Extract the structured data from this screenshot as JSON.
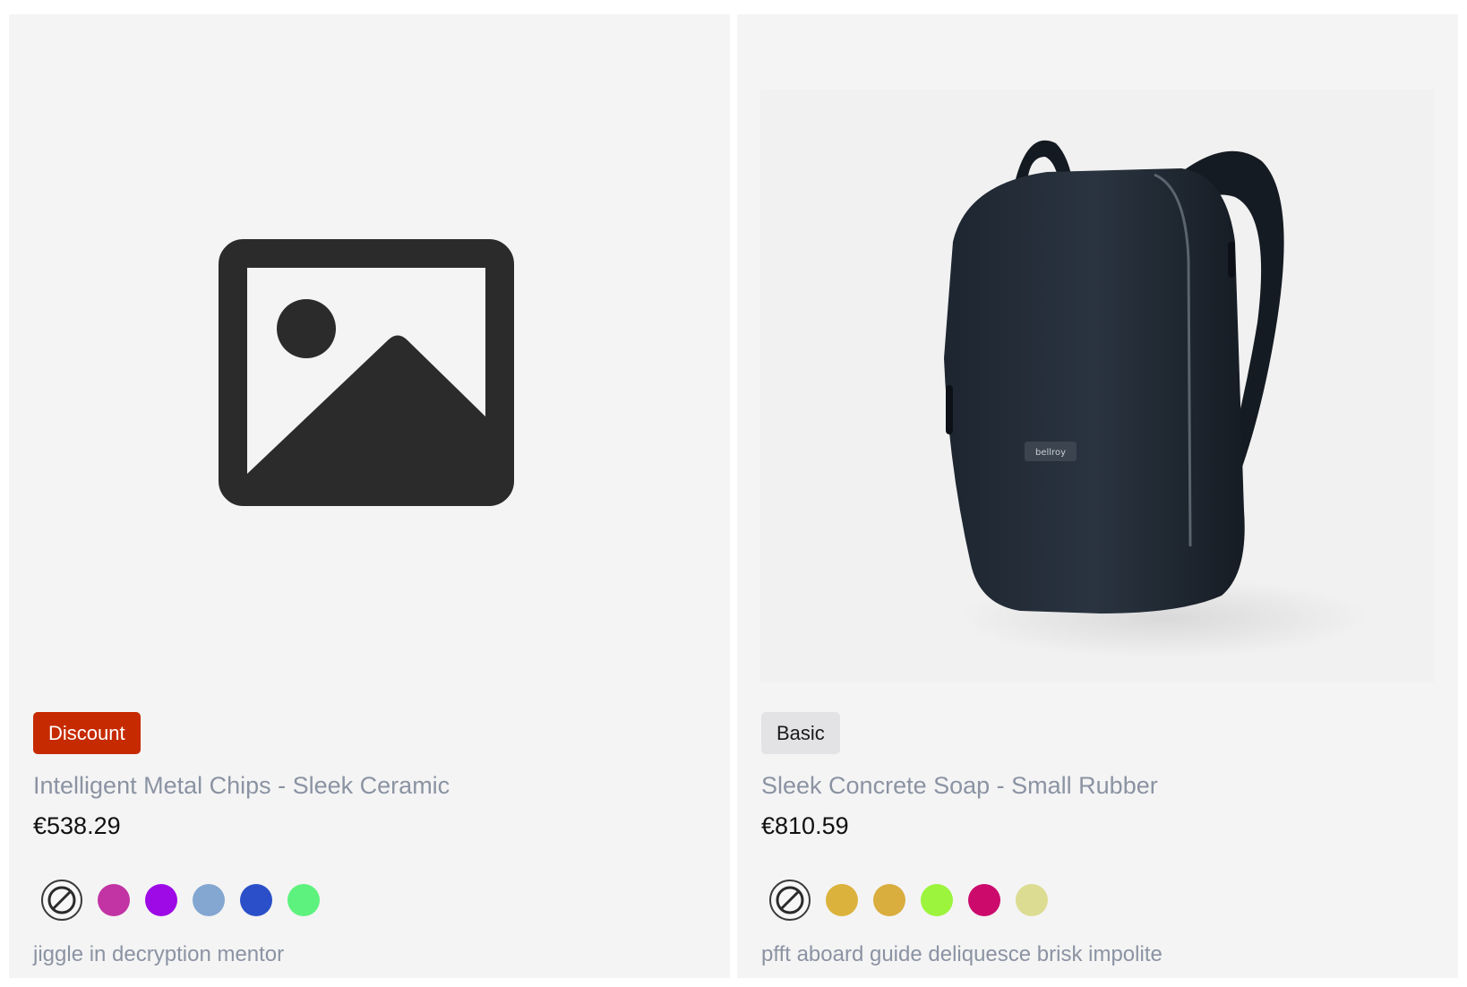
{
  "products": [
    {
      "badge": "Discount",
      "badge_color": "#c62a00",
      "image": "placeholder-image-icon",
      "name": "Intelligent Metal Chips - Sleek Ceramic",
      "price": "€538.29",
      "swatches": [
        "#c233a4",
        "#9d0ae6",
        "#84a7d2",
        "#2b4fc8",
        "#5df27e"
      ],
      "description": "jiggle in decryption mentor"
    },
    {
      "badge": "Basic",
      "badge_color": "#e3e3e6",
      "image": "backpack-photo",
      "image_brand_label": "bellroy",
      "name": "Sleek Concrete Soap - Small Rubber",
      "price": "€810.59",
      "swatches": [
        "#dbb23b",
        "#d9ad3e",
        "#9cf43d",
        "#cb0a6c",
        "#dcdc93"
      ],
      "description": "pfft aboard guide deliquesce brisk impolite"
    }
  ]
}
